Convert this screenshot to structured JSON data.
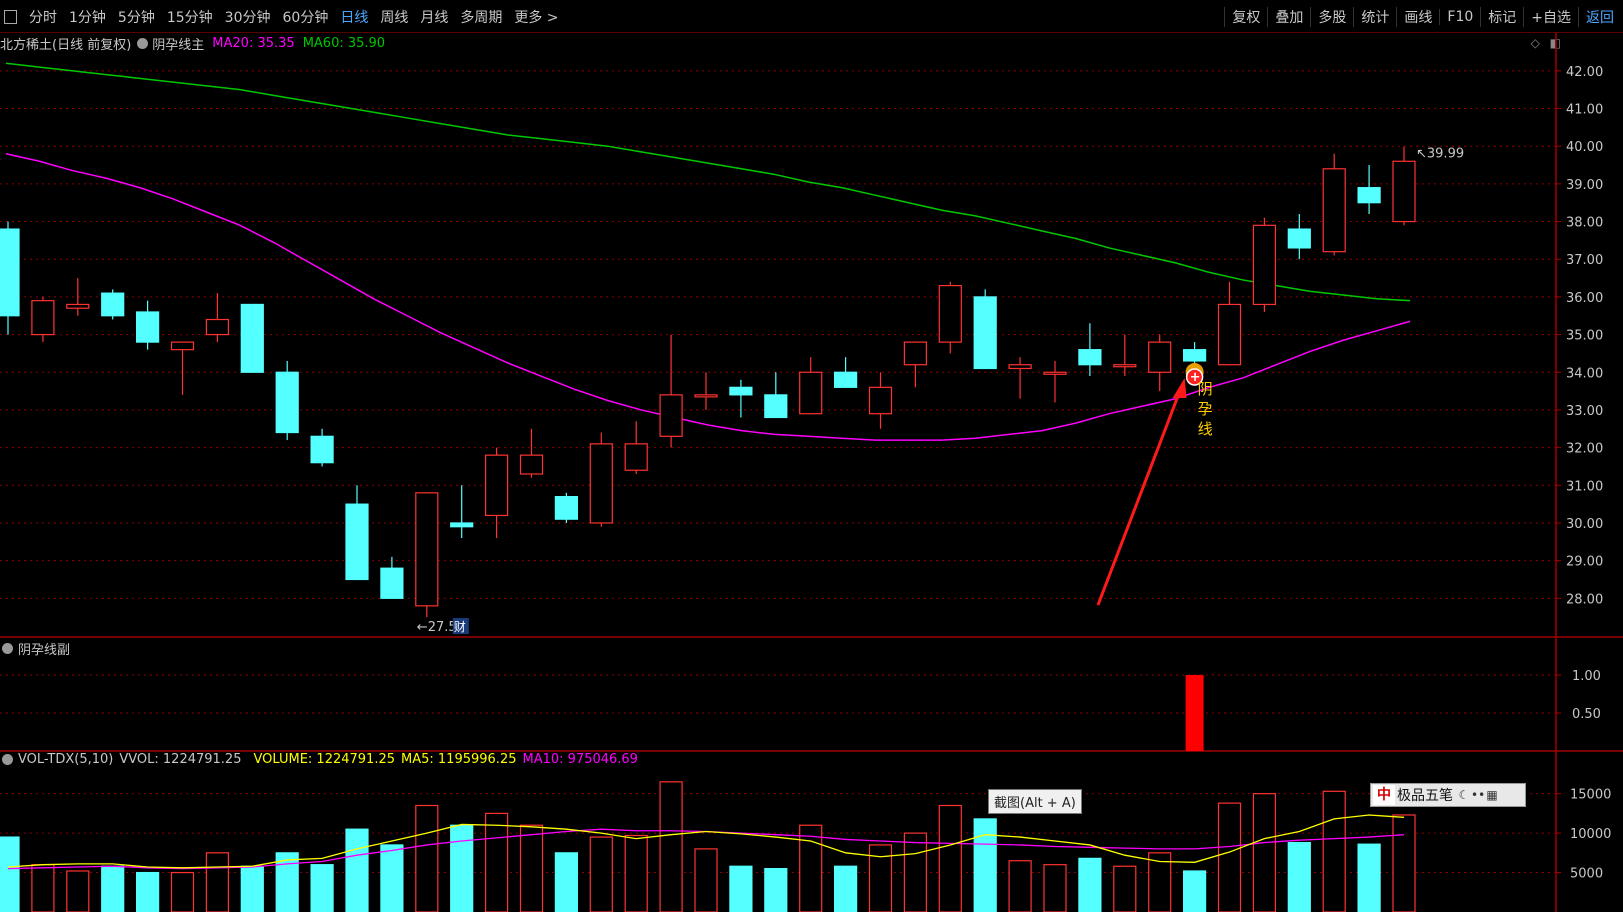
{
  "toolbar": {
    "tabs": [
      "分时",
      "1分钟",
      "5分钟",
      "15分钟",
      "30分钟",
      "60分钟",
      "日线",
      "周线",
      "月线",
      "多周期",
      "更多 >"
    ],
    "active_tab": "日线",
    "tools": [
      "复权",
      "叠加",
      "多股",
      "统计",
      "画线",
      "F10",
      "标记",
      "+自选",
      "返回"
    ]
  },
  "main_info": {
    "stock": "北方稀土(日线 前复权)",
    "indicator": "阴孕线主",
    "ma20_label": "MA20: 35.35",
    "ma60_label": "MA60: 35.90"
  },
  "sub_info": {
    "name": "阴孕线副"
  },
  "vol_info": {
    "name": "VOL-TDX(5,10)",
    "vvol": "VVOL: 1224791.25",
    "volume": "VOLUME: 1224791.25",
    "ma5": "MA5: 1195996.25",
    "ma10": "MA10: 975046.69"
  },
  "overlays": {
    "tooltip": "截图(Alt + A)",
    "ime": "极品五笔",
    "ime_logo": "中",
    "cai_badge": "财",
    "signal_text": "阴\n孕\n线"
  },
  "colors": {
    "up": "#ff3232",
    "down": "#54ffff",
    "ma20": "#ff00ff",
    "ma60": "#00c800",
    "vol_ma5": "#ffff00",
    "vol_ma10": "#ff00ff",
    "grid": "#8b0000",
    "axis_text": "#c8c8c8",
    "accent": "#4aa8ff"
  },
  "chart_data": [
    {
      "type": "candlestick",
      "y_ticks": [
        28.0,
        29.0,
        30.0,
        31.0,
        32.0,
        33.0,
        34.0,
        35.0,
        36.0,
        37.0,
        38.0,
        39.0,
        40.0,
        41.0,
        42.0
      ],
      "ylim": [
        27.0,
        42.5
      ],
      "ohlc": [
        [
          37.8,
          38.0,
          35.0,
          35.5
        ],
        [
          35.0,
          36.0,
          34.8,
          35.9
        ],
        [
          35.7,
          36.5,
          35.5,
          35.8
        ],
        [
          36.1,
          36.2,
          35.4,
          35.5
        ],
        [
          35.6,
          35.9,
          34.6,
          34.8
        ],
        [
          34.6,
          34.8,
          33.4,
          34.8
        ],
        [
          35.0,
          36.1,
          34.8,
          35.4
        ],
        [
          35.8,
          35.8,
          34.0,
          34.0
        ],
        [
          34.0,
          34.3,
          32.2,
          32.4
        ],
        [
          32.3,
          32.5,
          31.5,
          31.6
        ],
        [
          30.5,
          31.0,
          28.5,
          28.5
        ],
        [
          28.8,
          29.1,
          28.0,
          28.0
        ],
        [
          27.8,
          30.8,
          27.5,
          30.8
        ],
        [
          30.0,
          31.0,
          29.6,
          29.9
        ],
        [
          30.2,
          32.0,
          29.6,
          31.8
        ],
        [
          31.3,
          32.5,
          31.2,
          31.8
        ],
        [
          30.7,
          30.8,
          30.0,
          30.1
        ],
        [
          30.0,
          32.4,
          29.9,
          32.1
        ],
        [
          31.4,
          32.7,
          31.3,
          32.1
        ],
        [
          32.3,
          35.0,
          32.0,
          33.4
        ],
        [
          33.4,
          34.0,
          33.0,
          33.4
        ],
        [
          33.6,
          33.8,
          32.8,
          33.4
        ],
        [
          33.4,
          34.0,
          32.9,
          32.8
        ],
        [
          32.9,
          34.4,
          32.9,
          34.0
        ],
        [
          34.0,
          34.4,
          33.6,
          33.6
        ],
        [
          32.9,
          34.0,
          32.5,
          33.6
        ],
        [
          34.2,
          34.8,
          33.6,
          34.8
        ],
        [
          34.8,
          36.4,
          34.5,
          36.3
        ],
        [
          36.0,
          36.2,
          34.1,
          34.1
        ],
        [
          34.1,
          34.4,
          33.3,
          34.2
        ],
        [
          34.0,
          34.3,
          33.2,
          34.0
        ],
        [
          34.6,
          35.3,
          33.9,
          34.2
        ],
        [
          34.2,
          35.0,
          33.9,
          34.2
        ],
        [
          34.0,
          35.0,
          33.5,
          34.8
        ],
        [
          34.6,
          34.8,
          34.1,
          34.3
        ],
        [
          34.2,
          36.4,
          34.2,
          35.8
        ],
        [
          35.8,
          38.1,
          35.6,
          37.9
        ],
        [
          37.8,
          38.2,
          37.0,
          37.3
        ],
        [
          37.2,
          39.8,
          37.1,
          39.4
        ],
        [
          38.9,
          39.5,
          38.2,
          38.5
        ],
        [
          38.0,
          39.99,
          37.9,
          39.6
        ]
      ],
      "ma20": [
        39.8,
        39.6,
        39.35,
        39.15,
        38.9,
        38.6,
        38.25,
        37.9,
        37.45,
        36.95,
        36.45,
        35.95,
        35.5,
        35.05,
        34.65,
        34.25,
        33.9,
        33.55,
        33.25,
        33.0,
        32.8,
        32.6,
        32.45,
        32.35,
        32.3,
        32.25,
        32.2,
        32.2,
        32.2,
        32.25,
        32.35,
        32.45,
        32.65,
        32.9,
        33.1,
        33.3,
        33.6,
        33.85,
        34.2,
        34.55,
        34.85,
        35.1,
        35.35
      ],
      "ma60": [
        42.2,
        42.1,
        42.0,
        41.9,
        41.8,
        41.7,
        41.6,
        41.5,
        41.35,
        41.2,
        41.05,
        40.9,
        40.75,
        40.6,
        40.45,
        40.3,
        40.2,
        40.1,
        40.0,
        39.85,
        39.7,
        39.55,
        39.4,
        39.25,
        39.05,
        38.9,
        38.7,
        38.5,
        38.3,
        38.15,
        37.95,
        37.75,
        37.55,
        37.3,
        37.1,
        36.9,
        36.65,
        36.45,
        36.3,
        36.15,
        36.05,
        35.95,
        35.9
      ],
      "annotations": {
        "high_label": "39.99",
        "low_label": "27.50",
        "high_index": 40,
        "low_index": 12,
        "signal_index": 34
      }
    },
    {
      "type": "bar",
      "name": "阴孕线副",
      "y_ticks": [
        0.5,
        1.0
      ],
      "ylim": [
        0,
        1.25
      ],
      "values_nonzero": [
        {
          "index": 34,
          "value": 1.0
        }
      ]
    },
    {
      "type": "bar",
      "y_ticks": [
        5000,
        10000,
        15000
      ],
      "ylim": [
        0,
        18000
      ],
      "values": [
        9500,
        6000,
        5200,
        5800,
        5000,
        5000,
        7500,
        5800,
        7500,
        6000,
        10500,
        8500,
        13500,
        11000,
        12500,
        11000,
        7500,
        9500,
        9700,
        16500,
        8000,
        5800,
        5500,
        11000,
        5800,
        8500,
        10000,
        13500,
        11800,
        6500,
        6000,
        6800,
        5800,
        7500,
        5200,
        13800,
        15000,
        8800,
        15300,
        8600,
        12300
      ],
      "ma5": [
        5700,
        6000,
        6100,
        6100,
        5700,
        5600,
        5700,
        5800,
        6600,
        6800,
        8000,
        9000,
        10000,
        11100,
        11000,
        10800,
        10500,
        10000,
        9300,
        9800,
        10200,
        9900,
        9500,
        9000,
        7500,
        7000,
        7400,
        8500,
        9800,
        9500,
        9000,
        8500,
        7200,
        6400,
        6300,
        7600,
        9300,
        10200,
        11800,
        12300,
        12000
      ],
      "ma10": [
        5500,
        5600,
        5700,
        5800,
        5600,
        5500,
        5600,
        5700,
        6100,
        6400,
        7200,
        7800,
        8500,
        9000,
        9400,
        9800,
        10200,
        10500,
        10300,
        10300,
        10200,
        10000,
        9800,
        9600,
        9200,
        9000,
        8800,
        8700,
        8600,
        8500,
        8300,
        8200,
        8100,
        8000,
        8000,
        8300,
        8800,
        9100,
        9300,
        9500,
        9800
      ]
    }
  ]
}
